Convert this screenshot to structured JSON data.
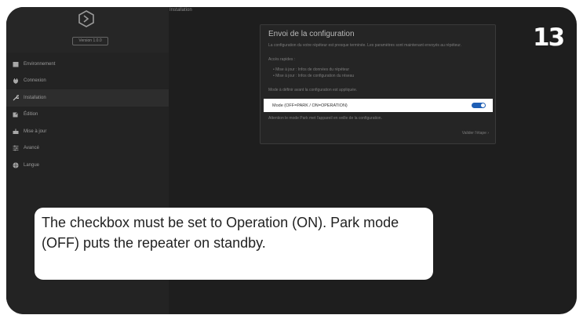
{
  "app": {
    "header_text": "Installation",
    "version": "Version 1.0.0"
  },
  "sidebar": {
    "items": [
      {
        "label": "Environnement",
        "icon": "building-icon"
      },
      {
        "label": "Connexion",
        "icon": "plug-icon"
      },
      {
        "label": "Installation",
        "icon": "wrench-icon",
        "active": true
      },
      {
        "label": "Édition",
        "icon": "edit-icon"
      },
      {
        "label": "Mise à jour",
        "icon": "update-icon"
      },
      {
        "label": "Avancé",
        "icon": "sliders-icon"
      },
      {
        "label": "Langue",
        "icon": "globe-icon"
      }
    ]
  },
  "config": {
    "title": "Envoi de la configuration",
    "description": "La configuration du votre répéteur est presque terminée. Les paramètres sont maintenant envoyés au répéteur.",
    "access_label": "Accès rapides :",
    "bullets": [
      "Mise à jour : Infos de données du répéteur",
      "Mise à jour : Infos de configuration du réseau"
    ],
    "note": "Mode à définir avant la configuration est appliquée.",
    "mode_label": "Mode (OFF=PARK / ON=OPERATION)",
    "mode_on": true,
    "warning": "Attention le mode Park met l'appareil en veille de la configuration.",
    "next_step": "Valider l'étape ›"
  },
  "step_number": "13",
  "tooltip": {
    "text": "The checkbox must be set to Operation (ON). Park mode (OFF) puts the repeater on standby."
  },
  "colors": {
    "background": "#1e1e1e",
    "sidebar": "#232323",
    "accent": "#1f5fb5",
    "tooltip_bg": "#ffffff"
  }
}
